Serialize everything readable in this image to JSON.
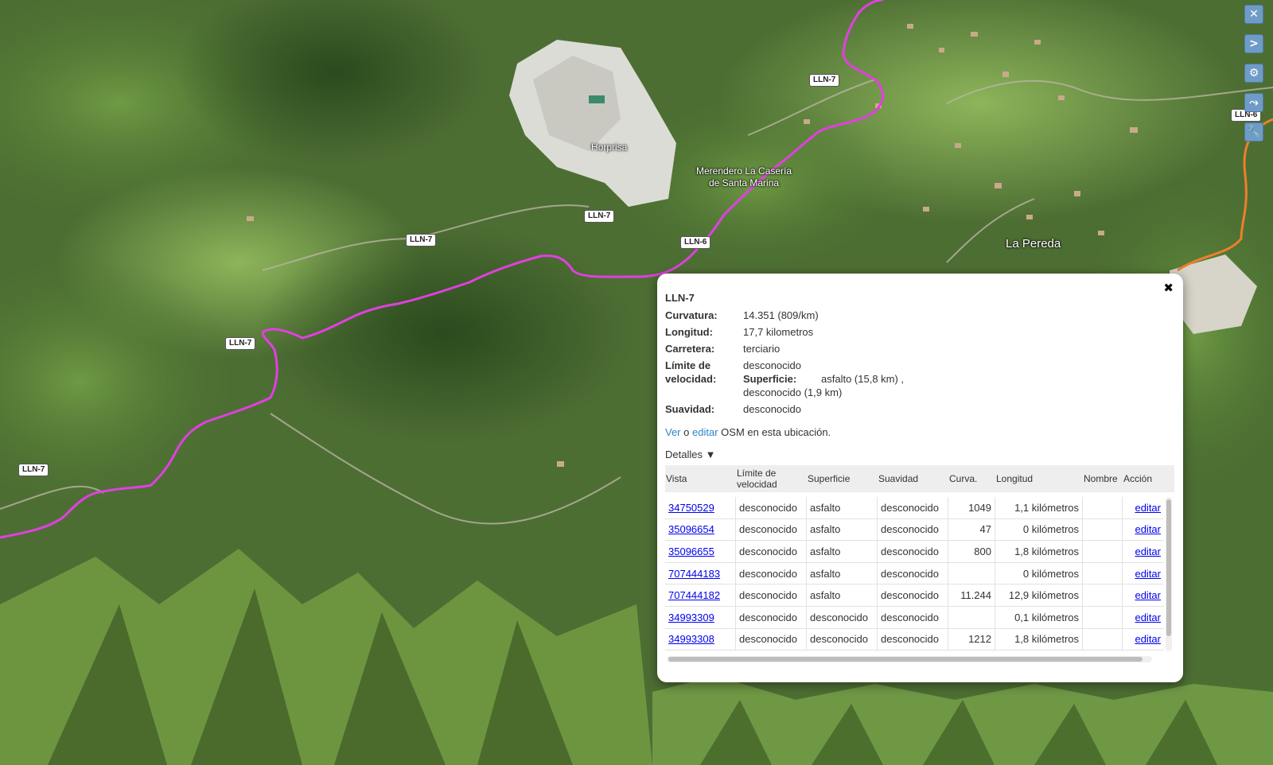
{
  "map": {
    "road_labels": [
      "LLN-7",
      "LLN-7",
      "LLN-7",
      "LLN-6",
      "LLN-7",
      "LLN-7",
      "LLN-6"
    ],
    "places": {
      "quarry": "Horprisa",
      "restaurant_line1": "Merendero La Casería",
      "restaurant_line2": "de Santa Marina",
      "town": "La Pereda"
    },
    "route_color": "#e040e0",
    "secondary_route_color": "#ef7f2a"
  },
  "controls": [
    {
      "icon": "close-icon",
      "glyph": "✕"
    },
    {
      "icon": "chevron-right-icon",
      "glyph": ">"
    },
    {
      "icon": "gear-icon",
      "glyph": "⚙"
    },
    {
      "icon": "route-icon",
      "glyph": "⤳"
    },
    {
      "icon": "wrench-icon",
      "glyph": "🔧"
    }
  ],
  "popup": {
    "close": "✖",
    "title": "LLN-7",
    "fields": {
      "curvatura_label": "Curvatura:",
      "curvatura": "14.351 (809/km)",
      "longitud_label": "Longitud:",
      "longitud": "17,7 kilometros",
      "carretera_label": "Carretera:",
      "carretera": "terciario",
      "limite_label_1": "Límite de",
      "limite_label_2": "velocidad:",
      "limite": "desconocido",
      "superficie_label": "Superficie:",
      "superficie_1": "asfalto (15,8 km) ,",
      "superficie_2": "desconocido (1,9 km)",
      "suavidad_label": "Suavidad:",
      "suavidad": "desconocido"
    },
    "osm": {
      "ver": "Ver",
      "o": "o",
      "editar": "editar",
      "rest": "OSM en esta ubicación."
    },
    "detalles": "Detalles ▼",
    "table": {
      "headers": [
        "Vista",
        "Límite de velocidad",
        "Superficie",
        "Suavidad",
        "Curva.",
        "Longitud",
        "Nombre",
        "Acción"
      ],
      "rows": [
        {
          "vista": "34750529",
          "limite": "desconocido",
          "superficie": "asfalto",
          "suavidad": "desconocido",
          "curva": "1049",
          "longitud": "1,1 kilómetros",
          "nombre": "",
          "accion": "editar"
        },
        {
          "vista": "35096654",
          "limite": "desconocido",
          "superficie": "asfalto",
          "suavidad": "desconocido",
          "curva": "47",
          "longitud": "0 kilómetros",
          "nombre": "",
          "accion": "editar"
        },
        {
          "vista": "35096655",
          "limite": "desconocido",
          "superficie": "asfalto",
          "suavidad": "desconocido",
          "curva": "800",
          "longitud": "1,8 kilómetros",
          "nombre": "",
          "accion": "editar"
        },
        {
          "vista": "707444183",
          "limite": "desconocido",
          "superficie": "asfalto",
          "suavidad": "desconocido",
          "curva": "",
          "longitud": "0 kilómetros",
          "nombre": "",
          "accion": "editar"
        },
        {
          "vista": "707444182",
          "limite": "desconocido",
          "superficie": "asfalto",
          "suavidad": "desconocido",
          "curva": "11.244",
          "longitud": "12,9 kilómetros",
          "nombre": "",
          "accion": "editar"
        },
        {
          "vista": "34993309",
          "limite": "desconocido",
          "superficie": "desconocido",
          "suavidad": "desconocido",
          "curva": "",
          "longitud": "0,1 kilómetros",
          "nombre": "",
          "accion": "editar"
        },
        {
          "vista": "34993308",
          "limite": "desconocido",
          "superficie": "desconocido",
          "suavidad": "desconocido",
          "curva": "1212",
          "longitud": "1,8 kilómetros",
          "nombre": "",
          "accion": "editar"
        }
      ]
    }
  }
}
